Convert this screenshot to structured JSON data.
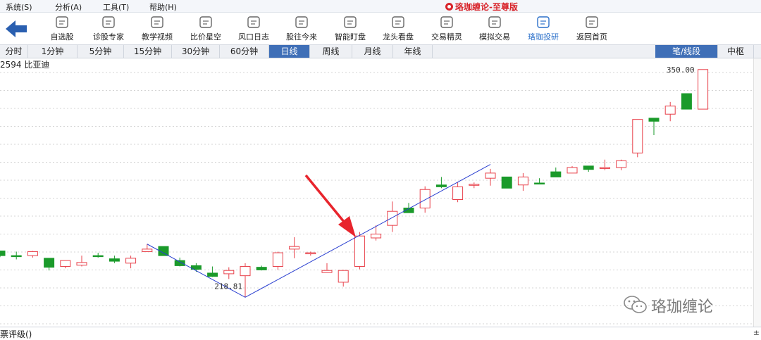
{
  "menu": {
    "items": [
      "系统(S)",
      "分析(A)",
      "工具(T)",
      "帮助(H)"
    ],
    "app_title": "珞珈缠论-至尊版"
  },
  "toolbar": {
    "buttons": [
      {
        "label": "自选股",
        "icon": "favorites-icon"
      },
      {
        "label": "诊股专家",
        "icon": "diagnose-icon"
      },
      {
        "label": "教学视频",
        "icon": "video-icon"
      },
      {
        "label": "比价星空",
        "icon": "compare-icon"
      },
      {
        "label": "风口日志",
        "icon": "journal-icon"
      },
      {
        "label": "股往今来",
        "icon": "history-icon"
      },
      {
        "label": "智能盯盘",
        "icon": "monitor-icon"
      },
      {
        "label": "龙头看盘",
        "icon": "leader-icon"
      },
      {
        "label": "交易精灵",
        "icon": "robot-icon"
      },
      {
        "label": "模拟交易",
        "icon": "simulate-icon"
      },
      {
        "label": "珞珈投研",
        "icon": "research-icon"
      },
      {
        "label": "返回首页",
        "icon": "home-icon"
      }
    ],
    "active_index": 10
  },
  "periods": {
    "tabs": [
      "分时",
      "1分钟",
      "5分钟",
      "15分钟",
      "30分钟",
      "60分钟",
      "日线",
      "周线",
      "月线",
      "年线"
    ],
    "active": "日线",
    "right_tabs": [
      "笔/线段",
      "中枢"
    ],
    "right_active": "笔/线段"
  },
  "stock": {
    "label": "2594 比亚迪"
  },
  "bottom": {
    "text": "票评级()",
    "scroll_marker": "±"
  },
  "watermark": "珞珈缠论",
  "colors": {
    "up": "#e8404a",
    "down": "#1a9a2a",
    "line": "#2a3fd0",
    "arrow": "#e8242c",
    "grid": "#c8c8c8"
  },
  "chart_data": {
    "type": "candlestick",
    "annotations": {
      "high_label": "350.00",
      "low_label": "218.81"
    },
    "candles": [
      {
        "o": 262.6,
        "h": 262.6,
        "l": 257.2,
        "c": 258.5,
        "up": false
      },
      {
        "o": 258.5,
        "h": 262.0,
        "l": 255.2,
        "c": 258.5,
        "up": false
      },
      {
        "o": 258.5,
        "h": 262.6,
        "l": 256.8,
        "c": 262.0,
        "up": true
      },
      {
        "o": 256.2,
        "h": 256.2,
        "l": 245.5,
        "c": 248.3,
        "up": false
      },
      {
        "o": 249.0,
        "h": 254.2,
        "l": 247.4,
        "c": 254.2,
        "up": true
      },
      {
        "o": 250.1,
        "h": 258.5,
        "l": 249.0,
        "c": 252.5,
        "up": true
      },
      {
        "o": 258.5,
        "h": 261.0,
        "l": 256.8,
        "c": 258.0,
        "up": false
      },
      {
        "o": 255.7,
        "h": 258.5,
        "l": 251.9,
        "c": 253.6,
        "up": false
      },
      {
        "o": 251.9,
        "h": 258.5,
        "l": 247.4,
        "c": 256.2,
        "up": true
      },
      {
        "o": 262.0,
        "h": 268.6,
        "l": 262.0,
        "c": 264.2,
        "up": true
      },
      {
        "o": 266.5,
        "h": 266.5,
        "l": 258.5,
        "c": 258.5,
        "up": false
      },
      {
        "o": 254.2,
        "h": 256.8,
        "l": 249.0,
        "c": 249.7,
        "up": false
      },
      {
        "o": 249.7,
        "h": 251.9,
        "l": 244.3,
        "c": 246.5,
        "up": false
      },
      {
        "o": 243.2,
        "h": 249.0,
        "l": 239.8,
        "c": 240.3,
        "up": false
      },
      {
        "o": 242.6,
        "h": 248.3,
        "l": 238.0,
        "c": 245.5,
        "up": true
      },
      {
        "o": 240.9,
        "h": 251.9,
        "l": 222.0,
        "c": 249.0,
        "up": true
      },
      {
        "o": 248.3,
        "h": 249.7,
        "l": 245.5,
        "c": 246.0,
        "up": false
      },
      {
        "o": 249.0,
        "h": 262.0,
        "l": 246.0,
        "c": 261.0,
        "up": true
      },
      {
        "o": 264.2,
        "h": 274.6,
        "l": 256.2,
        "c": 266.5,
        "up": true
      },
      {
        "o": 261.0,
        "h": 262.0,
        "l": 258.5,
        "c": 260.5,
        "up": true
      },
      {
        "o": 243.7,
        "h": 251.9,
        "l": 243.7,
        "c": 245.5,
        "up": true
      },
      {
        "o": 235.2,
        "h": 246.0,
        "l": 231.4,
        "c": 245.5,
        "up": true
      },
      {
        "o": 249.0,
        "h": 279.2,
        "l": 246.5,
        "c": 275.7,
        "up": true
      },
      {
        "o": 274.0,
        "h": 285.0,
        "l": 271.7,
        "c": 277.4,
        "up": true
      },
      {
        "o": 285.0,
        "h": 305.9,
        "l": 279.2,
        "c": 297.3,
        "up": true
      },
      {
        "o": 300.2,
        "h": 304.7,
        "l": 297.3,
        "c": 296.1,
        "up": false
      },
      {
        "o": 300.2,
        "h": 319.2,
        "l": 296.1,
        "c": 316.4,
        "up": true
      },
      {
        "o": 320.4,
        "h": 327.4,
        "l": 317.6,
        "c": 318.8,
        "up": false
      },
      {
        "o": 307.6,
        "h": 322.6,
        "l": 305.3,
        "c": 318.8,
        "up": true
      },
      {
        "o": 321.0,
        "h": 322.6,
        "l": 317.6,
        "c": 321.0,
        "up": true
      },
      {
        "o": 326.3,
        "h": 334.5,
        "l": 319.8,
        "c": 330.8,
        "up": true
      },
      {
        "o": 327.4,
        "h": 327.4,
        "l": 317.6,
        "c": 317.6,
        "up": false
      },
      {
        "o": 320.4,
        "h": 330.8,
        "l": 315.3,
        "c": 327.4,
        "up": true
      },
      {
        "o": 322.1,
        "h": 326.3,
        "l": 321.0,
        "c": 322.1,
        "up": false
      },
      {
        "o": 331.9,
        "h": 335.7,
        "l": 327.4,
        "c": 327.4,
        "up": false
      },
      {
        "o": 330.8,
        "h": 337.0,
        "l": 330.8,
        "c": 335.7,
        "up": true
      },
      {
        "o": 337.0,
        "h": 337.0,
        "l": 331.9,
        "c": 334.0,
        "up": false
      },
      {
        "o": 335.7,
        "h": 342.6,
        "l": 333.3,
        "c": 335.7,
        "up": true
      },
      {
        "o": 335.7,
        "h": 342.6,
        "l": 333.3,
        "c": 341.6,
        "up": true
      },
      {
        "o": 348.4,
        "h": 375.1,
        "l": 344.7,
        "c": 377.8,
        "up": true
      },
      {
        "o": 378.9,
        "h": 378.9,
        "l": 364.0,
        "c": 376.2,
        "up": false
      },
      {
        "o": 382.4,
        "h": 393.1,
        "l": 376.2,
        "c": 389.5,
        "up": true
      },
      {
        "o": 400.4,
        "h": 400.4,
        "l": 386.8,
        "c": 386.8,
        "up": false
      },
      {
        "o": 386.8,
        "h": 421.5,
        "l": 386.8,
        "c": 421.5,
        "up": true
      }
    ],
    "bi_points": [
      {
        "index": 9,
        "price": 268.6
      },
      {
        "index": 15,
        "price": 222.0
      },
      {
        "index": 30,
        "price": 338.4
      }
    ]
  }
}
